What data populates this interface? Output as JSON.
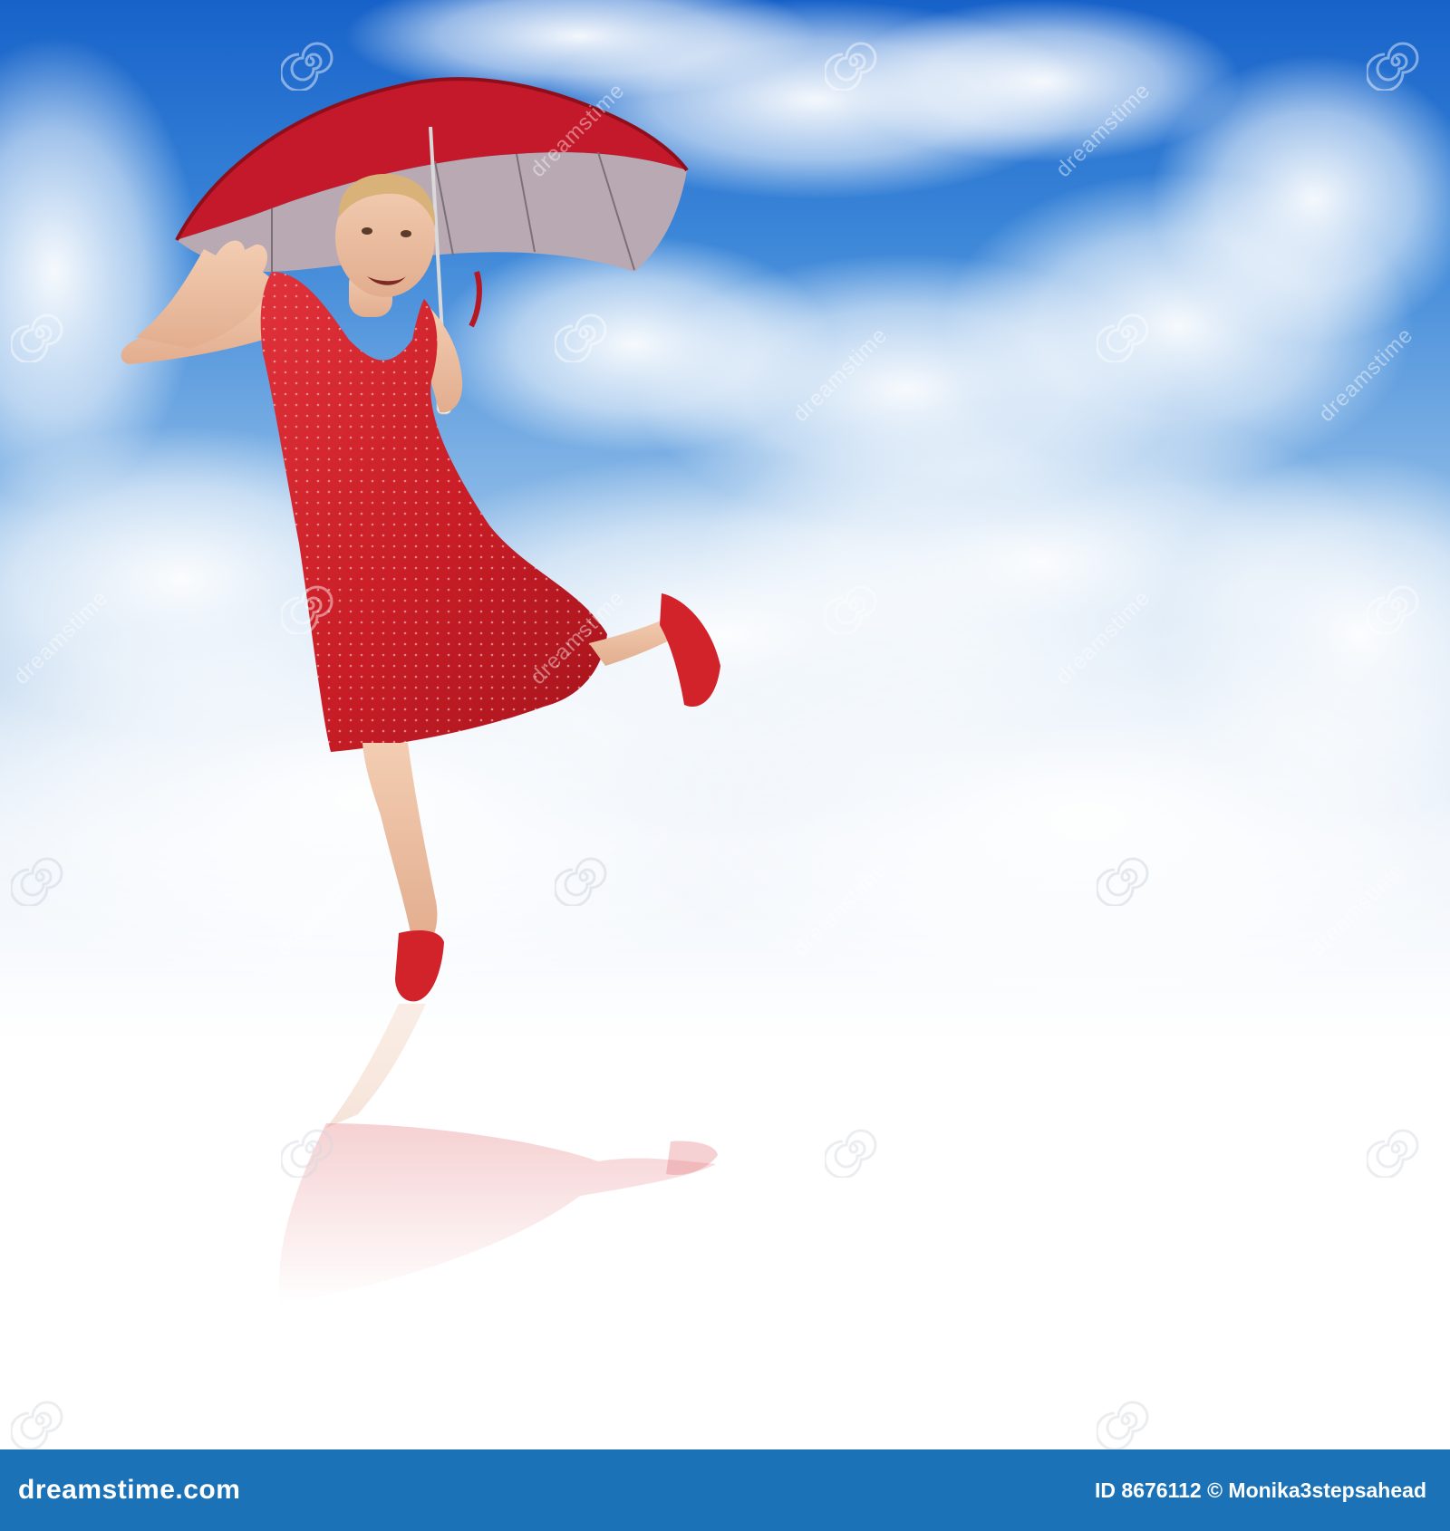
{
  "image": {
    "subject": "woman-red-dress-umbrella",
    "background": "sky-clouds",
    "colors": {
      "sky_top": "#1762c9",
      "dress": "#d2232a",
      "footer": "#1c72b6",
      "umbrella": "#c4192a"
    }
  },
  "watermark": {
    "text": "dreamstime",
    "icon": "spiral-icon"
  },
  "footer": {
    "brand": "dreamstime.com",
    "id_label": "ID 8676112",
    "credit": "© Monika3stepsahead"
  }
}
